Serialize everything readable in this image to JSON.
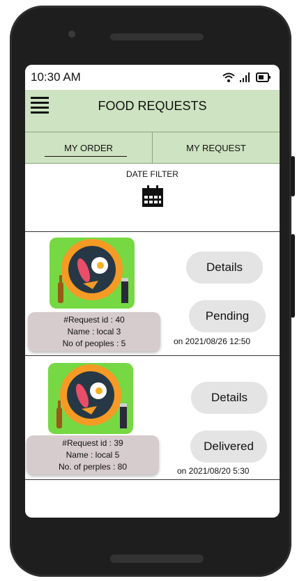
{
  "status_bar": {
    "time": "10:30 AM"
  },
  "app_bar": {
    "title": "FOOD REQUESTS"
  },
  "tabs": [
    {
      "label": "MY ORDER"
    },
    {
      "label": "MY REQUEST"
    }
  ],
  "date_filter": {
    "label": "DATE FILTER"
  },
  "requests": [
    {
      "id_text": "#Request id : 40",
      "name_text": "Name : local 3",
      "people_text": "No of peoples : 5",
      "details_label": "Details",
      "status_label": "Pending",
      "date_text": "on 2021/08/26 12:50"
    },
    {
      "id_text": "#Request id : 39",
      "name_text": "Name : local 5",
      "people_text": "No. of perples : 80",
      "details_label": "Details",
      "status_label": "Delivered",
      "date_text": "on 2021/08/20 5:30"
    }
  ],
  "colors": {
    "app_bar_bg": "#cde3c1",
    "image_bg": "#76d843",
    "info_card_bg": "#d7cccd",
    "pill_bg": "#e4e4e4",
    "phone_body": "#1e1e1e"
  },
  "icons": [
    "hamburger-menu-icon",
    "wifi-icon",
    "signal-icon",
    "battery-icon",
    "calendar-icon"
  ]
}
